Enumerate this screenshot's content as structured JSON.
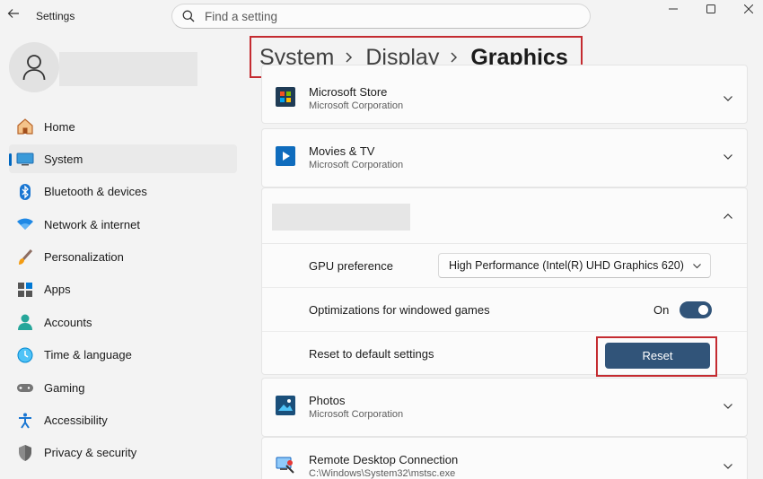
{
  "titlebar": {
    "app_title": "Settings",
    "search_placeholder": "Find a setting"
  },
  "sidebar": {
    "items": [
      {
        "label": "Home",
        "icon": "home-icon",
        "active": false
      },
      {
        "label": "System",
        "icon": "system-icon",
        "active": true
      },
      {
        "label": "Bluetooth & devices",
        "icon": "bluetooth-icon",
        "active": false
      },
      {
        "label": "Network & internet",
        "icon": "wifi-icon",
        "active": false
      },
      {
        "label": "Personalization",
        "icon": "brush-icon",
        "active": false
      },
      {
        "label": "Apps",
        "icon": "apps-icon",
        "active": false
      },
      {
        "label": "Accounts",
        "icon": "accounts-icon",
        "active": false
      },
      {
        "label": "Time & language",
        "icon": "globe-icon",
        "active": false
      },
      {
        "label": "Gaming",
        "icon": "gamepad-icon",
        "active": false
      },
      {
        "label": "Accessibility",
        "icon": "accessibility-icon",
        "active": false
      },
      {
        "label": "Privacy & security",
        "icon": "shield-icon",
        "active": false
      }
    ]
  },
  "breadcrumb": {
    "items": [
      "System",
      "Display",
      "Graphics"
    ]
  },
  "apps": {
    "microsoft_store": {
      "name": "Microsoft Store",
      "publisher": "Microsoft Corporation"
    },
    "movies_tv": {
      "name": "Movies & TV",
      "publisher": "Microsoft Corporation"
    },
    "photos": {
      "name": "Photos",
      "publisher": "Microsoft Corporation"
    },
    "remote_desktop": {
      "name": "Remote Desktop Connection",
      "publisher": "C:\\Windows\\System32\\mstsc.exe"
    }
  },
  "expanded_app": {
    "gpu_preference_label": "GPU preference",
    "gpu_preference_value": "High Performance (Intel(R) UHD Graphics 620)",
    "windowed_opt_label": "Optimizations for windowed games",
    "windowed_opt_state": "On",
    "reset_label": "Reset to default settings",
    "reset_button": "Reset"
  },
  "colors": {
    "accent": "#315479",
    "highlight_border": "#c42b30",
    "nav_indicator": "#0067c0"
  }
}
